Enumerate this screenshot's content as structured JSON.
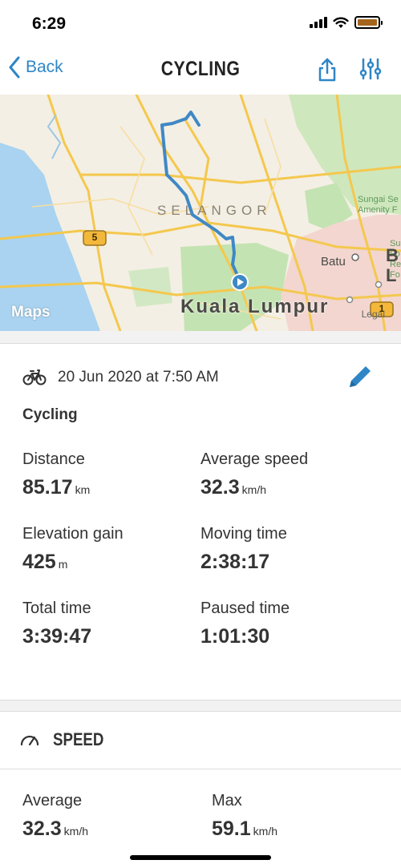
{
  "status_bar": {
    "time": "6:29",
    "battery_color": "#a5651d"
  },
  "nav": {
    "back_label": "Back",
    "title": "CYCLING",
    "accent_color": "#2f86c6",
    "icons": [
      "chevron-left-icon",
      "share-icon",
      "sliders-icon"
    ]
  },
  "map": {
    "labels": {
      "region": "SELANGOR",
      "city": "Kuala Lumpur",
      "town": "Batu",
      "edge_b": "B",
      "edge_l": "L",
      "park_top": "Sungai Se\nAmenity F",
      "park_side": "Su\nFo\nRe\nFo",
      "route_5": "5",
      "route_1": "1"
    },
    "provider": "Maps",
    "legal": "Legal"
  },
  "activity": {
    "date": "20 Jun 2020 at 7:50 AM",
    "type": "Cycling",
    "stats": [
      {
        "label": "Distance",
        "value": "85.17",
        "unit": "km"
      },
      {
        "label": "Average speed",
        "value": "32.3",
        "unit": "km/h"
      },
      {
        "label": "Elevation gain",
        "value": "425",
        "unit": "m"
      },
      {
        "label": "Moving time",
        "value": "2:38:17",
        "unit": ""
      },
      {
        "label": "Total time",
        "value": "3:39:47",
        "unit": ""
      },
      {
        "label": "Paused time",
        "value": "1:01:30",
        "unit": ""
      }
    ]
  },
  "speed": {
    "title": "SPEED",
    "stats": [
      {
        "label": "Average",
        "value": "32.3",
        "unit": "km/h"
      },
      {
        "label": "Max",
        "value": "59.1",
        "unit": "km/h"
      }
    ]
  }
}
